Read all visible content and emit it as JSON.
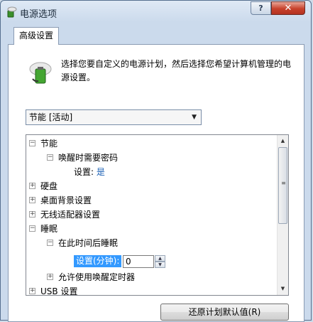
{
  "window": {
    "title": "电源选项",
    "help_glyph": "?",
    "close_glyph": "✕"
  },
  "tab": {
    "label": "高级设置"
  },
  "description": "选择您要自定义的电源计划，然后选择您希望计算机管理的电源设置。",
  "plan_select": {
    "value": "节能 [活动]"
  },
  "tree": {
    "items": [
      {
        "label": "节能",
        "expander": "⊟"
      },
      {
        "label": "唤醒时需要密码",
        "expander": "⊟"
      },
      {
        "label": "设置:",
        "value": "是"
      },
      {
        "label": "硬盘",
        "expander": "⊞"
      },
      {
        "label": "桌面背景设置",
        "expander": "⊞"
      },
      {
        "label": "无线适配器设置",
        "expander": "⊞"
      },
      {
        "label": "睡眠",
        "expander": "⊟"
      },
      {
        "label": "在此时间后睡眠",
        "expander": "⊟"
      },
      {
        "label": "设置(分钟):",
        "value": "0"
      },
      {
        "label": "允许使用唤醒定时器",
        "expander": "⊞"
      },
      {
        "label": "USB 设置",
        "expander": "⊞"
      }
    ]
  },
  "restore_button": {
    "label": "还原计划默认值(R)"
  }
}
